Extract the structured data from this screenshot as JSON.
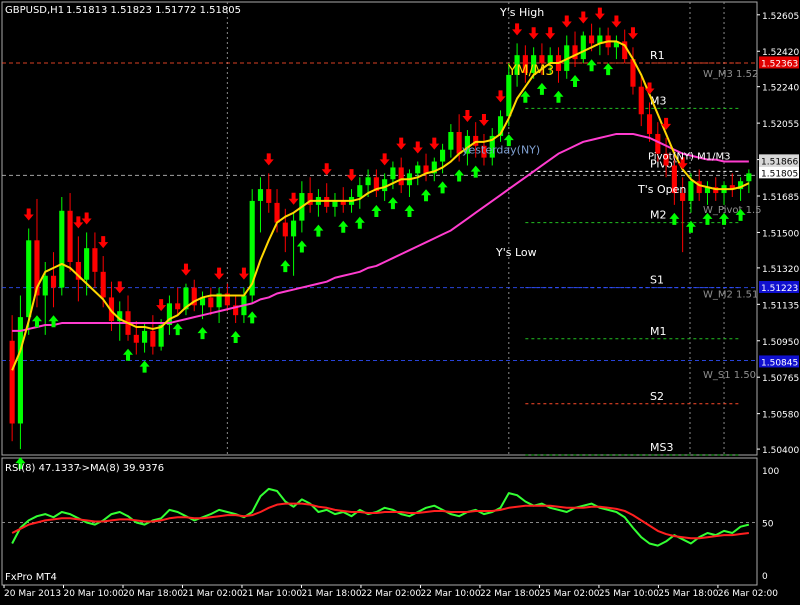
{
  "header": {
    "symbol": "GBPUSD,H1",
    "ohlc": "1.51813 1.51823 1.51772 1.51805",
    "rsi_label": "RSI(8) 47.1337",
    "rsi_ma_label": "->MA(8) 39.9376",
    "broker": "FxPro MT4"
  },
  "colors": {
    "bull": "#00ff00",
    "bear": "#ff0000",
    "ma_fast": "#ffd700",
    "ma_slow": "#ff3ccf",
    "rsi": "#33ff33",
    "rsi_ma": "#ff2020",
    "axis": "#ffffff",
    "grid": "#5a5a5a"
  },
  "chart_data": [
    {
      "type": "candlestick",
      "title": "GBPUSD,H1",
      "x_ticks": [
        "20 Mar 2013",
        "20 Mar 10:00",
        "20 Mar 18:00",
        "21 Mar 02:00",
        "21 Mar 10:00",
        "21 Mar 18:00",
        "22 Mar 02:00",
        "22 Mar 10:00",
        "22 Mar 18:00",
        "25 Mar 02:00",
        "25 Mar 10:00",
        "25 Mar 18:00",
        "26 Mar 02:00"
      ],
      "y_ticks": [
        "1.52605",
        "1.52420",
        "1.52240",
        "1.52055",
        "1.51870",
        "1.51685",
        "1.51500",
        "1.51320",
        "1.51135",
        "1.50950",
        "1.50765",
        "1.50580",
        "1.50400"
      ],
      "ylim": [
        1.5037,
        1.5267
      ],
      "current_price": "1.51805",
      "price_tags": [
        {
          "label": "1.52363",
          "value": 1.52363,
          "bg": "#e00000",
          "fg": "#ffffff"
        },
        {
          "label": "1.51866",
          "value": 1.51866,
          "bg": "#d8d8d8",
          "fg": "#000000"
        },
        {
          "label": "1.51223",
          "value": 1.51223,
          "bg": "#1010d0",
          "fg": "#ffffff"
        },
        {
          "label": "1.50845",
          "value": 1.50845,
          "bg": "#1010d0",
          "fg": "#ffffff"
        }
      ],
      "levels": [
        {
          "label": "R1",
          "value": 1.5236,
          "color": "#ff4a2a"
        },
        {
          "label": "M3",
          "value": 1.5213,
          "color": "#22c022"
        },
        {
          "label": "Pivot",
          "value": 1.5181,
          "color": "#ffffff"
        },
        {
          "label": "M2",
          "value": 1.5155,
          "color": "#22c022"
        },
        {
          "label": "S1",
          "value": 1.5122,
          "color": "#3050ff"
        },
        {
          "label": "M1",
          "value": 1.5096,
          "color": "#22c022"
        },
        {
          "label": "S2",
          "value": 1.5063,
          "color": "#ff4a2a"
        },
        {
          "label": "MS3",
          "value": 1.5037,
          "color": "#22c022"
        }
      ],
      "weekly_labels": [
        {
          "label": "W_M3 1.52",
          "value": 1.5231
        },
        {
          "label": "W_Pivot 1.5",
          "value": 1.5162
        },
        {
          "label": "W_M2 1.51",
          "value": 1.5119
        },
        {
          "label": "W_S1 1.50",
          "value": 1.5078
        }
      ],
      "annotations": [
        {
          "label": "Y's High",
          "value": 1.526
        },
        {
          "label": "YM/M3",
          "value": 1.523
        },
        {
          "label": "yesterday(NY)",
          "value": 1.519
        },
        {
          "label": "T's Open",
          "value": 1.517
        },
        {
          "label": "Y's Low",
          "value": 1.5138
        },
        {
          "label": "Pivot(NY) M1/M3",
          "value": 1.5187
        }
      ],
      "candles": [
        [
          1.5095,
          1.5108,
          1.5044,
          1.5053
        ],
        [
          1.5053,
          1.5118,
          1.504,
          1.5107
        ],
        [
          1.5107,
          1.5152,
          1.5098,
          1.5146
        ],
        [
          1.5146,
          1.5167,
          1.5112,
          1.5118
        ],
        [
          1.5118,
          1.5135,
          1.5098,
          1.5128
        ],
        [
          1.5128,
          1.514,
          1.5112,
          1.5122
        ],
        [
          1.5122,
          1.5168,
          1.5118,
          1.5161
        ],
        [
          1.5161,
          1.517,
          1.513,
          1.5135
        ],
        [
          1.5135,
          1.5148,
          1.5115,
          1.5126
        ],
        [
          1.5126,
          1.515,
          1.5118,
          1.5142
        ],
        [
          1.5142,
          1.515,
          1.5122,
          1.513
        ],
        [
          1.513,
          1.5138,
          1.5112,
          1.5117
        ],
        [
          1.5117,
          1.5125,
          1.51,
          1.5105
        ],
        [
          1.5105,
          1.5115,
          1.5095,
          1.511
        ],
        [
          1.511,
          1.5118,
          1.5095,
          1.5098
        ],
        [
          1.5098,
          1.5105,
          1.5088,
          1.5094
        ],
        [
          1.5094,
          1.5104,
          1.5089,
          1.51
        ],
        [
          1.51,
          1.5108,
          1.5088,
          1.5092
        ],
        [
          1.5092,
          1.5106,
          1.509,
          1.5103
        ],
        [
          1.5103,
          1.5118,
          1.5098,
          1.5114
        ],
        [
          1.5114,
          1.5122,
          1.5108,
          1.5111
        ],
        [
          1.5111,
          1.5124,
          1.5108,
          1.5122
        ],
        [
          1.5122,
          1.5126,
          1.511,
          1.5113
        ],
        [
          1.5113,
          1.512,
          1.5106,
          1.5117
        ],
        [
          1.5117,
          1.5122,
          1.5108,
          1.5112
        ],
        [
          1.5112,
          1.5122,
          1.5104,
          1.5119
        ],
        [
          1.5119,
          1.5124,
          1.511,
          1.5113
        ],
        [
          1.5113,
          1.5118,
          1.5104,
          1.5108
        ],
        [
          1.5108,
          1.5122,
          1.5104,
          1.5118
        ],
        [
          1.5118,
          1.5172,
          1.5114,
          1.5166
        ],
        [
          1.5166,
          1.5178,
          1.515,
          1.5172
        ],
        [
          1.5172,
          1.518,
          1.516,
          1.5165
        ],
        [
          1.5165,
          1.5172,
          1.515,
          1.5155
        ],
        [
          1.5155,
          1.5162,
          1.514,
          1.5148
        ],
        [
          1.5148,
          1.516,
          1.5128,
          1.5156
        ],
        [
          1.5156,
          1.5176,
          1.515,
          1.517
        ],
        [
          1.517,
          1.5178,
          1.516,
          1.5164
        ],
        [
          1.5164,
          1.5172,
          1.5158,
          1.5168
        ],
        [
          1.5168,
          1.5175,
          1.516,
          1.5163
        ],
        [
          1.5163,
          1.517,
          1.5158,
          1.5166
        ],
        [
          1.5166,
          1.5173,
          1.516,
          1.5164
        ],
        [
          1.5164,
          1.5172,
          1.516,
          1.5168
        ],
        [
          1.5168,
          1.5178,
          1.5162,
          1.5174
        ],
        [
          1.5174,
          1.5182,
          1.5168,
          1.5178
        ],
        [
          1.5178,
          1.5182,
          1.5168,
          1.5171
        ],
        [
          1.5171,
          1.518,
          1.5166,
          1.5177
        ],
        [
          1.5177,
          1.5186,
          1.5172,
          1.5183
        ],
        [
          1.5183,
          1.5188,
          1.517,
          1.5174
        ],
        [
          1.5174,
          1.5182,
          1.5168,
          1.518
        ],
        [
          1.518,
          1.5186,
          1.5174,
          1.5184
        ],
        [
          1.5184,
          1.519,
          1.5176,
          1.518
        ],
        [
          1.518,
          1.5188,
          1.5176,
          1.5186
        ],
        [
          1.5186,
          1.5195,
          1.518,
          1.5192
        ],
        [
          1.5192,
          1.5205,
          1.5188,
          1.5201
        ],
        [
          1.5201,
          1.521,
          1.5186,
          1.519
        ],
        [
          1.519,
          1.5202,
          1.5184,
          1.5199
        ],
        [
          1.5199,
          1.5206,
          1.5188,
          1.5194
        ],
        [
          1.5194,
          1.52,
          1.5184,
          1.5188
        ],
        [
          1.5188,
          1.5203,
          1.5184,
          1.5199
        ],
        [
          1.5199,
          1.5212,
          1.5196,
          1.5209
        ],
        [
          1.5209,
          1.5236,
          1.5204,
          1.523
        ],
        [
          1.523,
          1.5246,
          1.5224,
          1.524
        ],
        [
          1.524,
          1.5245,
          1.5226,
          1.5231
        ],
        [
          1.5231,
          1.5244,
          1.5228,
          1.524
        ],
        [
          1.524,
          1.5246,
          1.523,
          1.5236
        ],
        [
          1.5236,
          1.5244,
          1.523,
          1.524
        ],
        [
          1.524,
          1.5244,
          1.5226,
          1.5232
        ],
        [
          1.5232,
          1.525,
          1.5228,
          1.5245
        ],
        [
          1.5245,
          1.5252,
          1.5234,
          1.5238
        ],
        [
          1.5238,
          1.5252,
          1.5236,
          1.525
        ],
        [
          1.525,
          1.5256,
          1.5242,
          1.5246
        ],
        [
          1.5246,
          1.5254,
          1.524,
          1.525
        ],
        [
          1.525,
          1.5254,
          1.524,
          1.5244
        ],
        [
          1.5244,
          1.525,
          1.5238,
          1.5247
        ],
        [
          1.5247,
          1.5253,
          1.5236,
          1.5238
        ],
        [
          1.5238,
          1.5244,
          1.522,
          1.5224
        ],
        [
          1.5224,
          1.523,
          1.5204,
          1.521
        ],
        [
          1.521,
          1.5216,
          1.5196,
          1.52
        ],
        [
          1.52,
          1.5206,
          1.5186,
          1.519
        ],
        [
          1.519,
          1.5198,
          1.5178,
          1.5184
        ],
        [
          1.5184,
          1.519,
          1.5164,
          1.517
        ],
        [
          1.517,
          1.5178,
          1.514,
          1.5166
        ],
        [
          1.5166,
          1.518,
          1.516,
          1.5176
        ],
        [
          1.5176,
          1.5182,
          1.5166,
          1.517
        ],
        [
          1.517,
          1.5176,
          1.5164,
          1.5173
        ],
        [
          1.5173,
          1.5178,
          1.5166,
          1.517
        ],
        [
          1.517,
          1.5176,
          1.5164,
          1.5174
        ],
        [
          1.5174,
          1.518,
          1.5168,
          1.5172
        ],
        [
          1.5172,
          1.5178,
          1.5166,
          1.5176
        ],
        [
          1.5176,
          1.5182,
          1.517,
          1.518
        ]
      ],
      "ma_fast": [
        1.508,
        1.509,
        1.5105,
        1.5122,
        1.513,
        1.5132,
        1.5134,
        1.5132,
        1.5128,
        1.5124,
        1.512,
        1.5116,
        1.511,
        1.5106,
        1.5104,
        1.5102,
        1.5102,
        1.5101,
        1.5102,
        1.5106,
        1.5108,
        1.5112,
        1.5115,
        1.5117,
        1.5118,
        1.5118,
        1.5118,
        1.5118,
        1.5118,
        1.5124,
        1.5136,
        1.5146,
        1.5155,
        1.5158,
        1.516,
        1.5163,
        1.5166,
        1.5166,
        1.5166,
        1.5166,
        1.5166,
        1.5166,
        1.5167,
        1.517,
        1.5172,
        1.5173,
        1.5175,
        1.5177,
        1.5177,
        1.5178,
        1.518,
        1.5181,
        1.5183,
        1.5186,
        1.519,
        1.5193,
        1.5196,
        1.5196,
        1.5197,
        1.52,
        1.5208,
        1.5218,
        1.5224,
        1.523,
        1.5233,
        1.5236,
        1.5236,
        1.5238,
        1.524,
        1.5242,
        1.5244,
        1.5246,
        1.5247,
        1.5247,
        1.5245,
        1.5238,
        1.523,
        1.522,
        1.521,
        1.52,
        1.519,
        1.5182,
        1.5177,
        1.5174,
        1.5173,
        1.5172,
        1.5172,
        1.5172,
        1.5173,
        1.5175
      ],
      "ma_slow": [
        1.51,
        1.51,
        1.5101,
        1.5102,
        1.5103,
        1.5103,
        1.5104,
        1.5104,
        1.5104,
        1.5104,
        1.5104,
        1.5104,
        1.5104,
        1.5104,
        1.5104,
        1.5104,
        1.5104,
        1.5104,
        1.5104,
        1.5104,
        1.5105,
        1.5106,
        1.5107,
        1.5108,
        1.5109,
        1.511,
        1.5111,
        1.5112,
        1.5113,
        1.5114,
        1.5116,
        1.5117,
        1.5119,
        1.512,
        1.5121,
        1.5122,
        1.5123,
        1.5124,
        1.5125,
        1.5127,
        1.5128,
        1.5129,
        1.513,
        1.5132,
        1.5133,
        1.5135,
        1.5137,
        1.5139,
        1.5141,
        1.5143,
        1.5145,
        1.5147,
        1.5149,
        1.5151,
        1.5154,
        1.5157,
        1.516,
        1.5163,
        1.5166,
        1.5169,
        1.5172,
        1.5175,
        1.5178,
        1.5181,
        1.5184,
        1.5187,
        1.519,
        1.5192,
        1.5194,
        1.5196,
        1.5197,
        1.5198,
        1.5199,
        1.52,
        1.52,
        1.52,
        1.5199,
        1.5198,
        1.5196,
        1.5194,
        1.5192,
        1.519,
        1.5189,
        1.5188,
        1.5187,
        1.5187,
        1.5186,
        1.5186,
        1.5186,
        1.5186
      ],
      "up_arrows": [
        1,
        3,
        5,
        14,
        16,
        20,
        23,
        27,
        29,
        33,
        35,
        37,
        40,
        42,
        44,
        46,
        48,
        50,
        52,
        54,
        56,
        60,
        62,
        64,
        66,
        68,
        70,
        72,
        80,
        82,
        84,
        86,
        88
      ],
      "down_arrows": [
        2,
        8,
        9,
        11,
        13,
        18,
        21,
        25,
        28,
        31,
        34,
        38,
        41,
        45,
        47,
        49,
        51,
        55,
        57,
        59,
        61,
        63,
        65,
        67,
        69,
        71,
        73,
        75,
        77,
        79,
        81
      ]
    },
    {
      "type": "line",
      "title": "RSI(8) 47.1337 ->MA(8) 39.9376",
      "y_ticks": [
        "100",
        "50",
        "0"
      ],
      "ylim": [
        0,
        100
      ],
      "series": [
        {
          "name": "RSI(8) 47.1337",
          "values": [
            30,
            45,
            52,
            56,
            58,
            55,
            60,
            58,
            54,
            50,
            48,
            52,
            58,
            60,
            56,
            50,
            48,
            52,
            54,
            62,
            60,
            56,
            52,
            55,
            58,
            62,
            60,
            58,
            55,
            60,
            75,
            82,
            80,
            70,
            65,
            72,
            68,
            60,
            62,
            58,
            60,
            56,
            62,
            58,
            60,
            64,
            62,
            58,
            56,
            60,
            64,
            66,
            62,
            58,
            56,
            60,
            62,
            58,
            60,
            64,
            78,
            76,
            70,
            66,
            68,
            64,
            62,
            60,
            64,
            66,
            68,
            64,
            62,
            60,
            55,
            45,
            36,
            30,
            28,
            32,
            38,
            34,
            30,
            36,
            40,
            38,
            42,
            40,
            46,
            48
          ]
        },
        {
          "name": "->MA(8) 39.9376",
          "values": [
            40,
            44,
            48,
            50,
            52,
            53,
            54,
            54,
            53,
            52,
            51,
            51,
            52,
            53,
            53,
            52,
            51,
            51,
            52,
            54,
            55,
            55,
            54,
            54,
            55,
            56,
            57,
            57,
            56,
            57,
            60,
            64,
            67,
            68,
            68,
            68,
            67,
            65,
            64,
            62,
            61,
            60,
            60,
            59,
            59,
            60,
            60,
            60,
            59,
            59,
            60,
            61,
            61,
            60,
            60,
            60,
            61,
            61,
            61,
            62,
            64,
            65,
            66,
            66,
            66,
            66,
            65,
            64,
            64,
            64,
            65,
            65,
            64,
            63,
            61,
            57,
            52,
            47,
            42,
            39,
            37,
            36,
            35,
            35,
            36,
            37,
            38,
            38,
            39,
            40
          ]
        }
      ]
    }
  ]
}
